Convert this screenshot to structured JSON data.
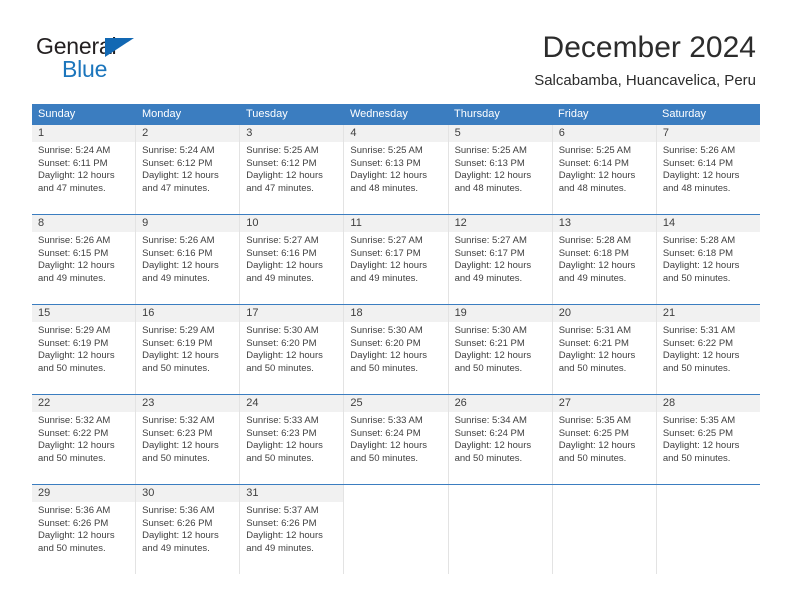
{
  "logo": {
    "word_one": "General",
    "word_two": "Blue",
    "triangle_icon": "triangle-icon",
    "primary_color": "#1b75bc",
    "dark_color": "#231f20"
  },
  "header": {
    "title": "December 2024",
    "subtitle": "Salcabamba, Huancavelica, Peru"
  },
  "calendar": {
    "header_bg": "#3b7dc0",
    "weekdays": [
      "Sunday",
      "Monday",
      "Tuesday",
      "Wednesday",
      "Thursday",
      "Friday",
      "Saturday"
    ],
    "weeks": [
      [
        {
          "day": "1",
          "sunrise": "Sunrise: 5:24 AM",
          "sunset": "Sunset: 6:11 PM",
          "daylight": "Daylight: 12 hours and 47 minutes."
        },
        {
          "day": "2",
          "sunrise": "Sunrise: 5:24 AM",
          "sunset": "Sunset: 6:12 PM",
          "daylight": "Daylight: 12 hours and 47 minutes."
        },
        {
          "day": "3",
          "sunrise": "Sunrise: 5:25 AM",
          "sunset": "Sunset: 6:12 PM",
          "daylight": "Daylight: 12 hours and 47 minutes."
        },
        {
          "day": "4",
          "sunrise": "Sunrise: 5:25 AM",
          "sunset": "Sunset: 6:13 PM",
          "daylight": "Daylight: 12 hours and 48 minutes."
        },
        {
          "day": "5",
          "sunrise": "Sunrise: 5:25 AM",
          "sunset": "Sunset: 6:13 PM",
          "daylight": "Daylight: 12 hours and 48 minutes."
        },
        {
          "day": "6",
          "sunrise": "Sunrise: 5:25 AM",
          "sunset": "Sunset: 6:14 PM",
          "daylight": "Daylight: 12 hours and 48 minutes."
        },
        {
          "day": "7",
          "sunrise": "Sunrise: 5:26 AM",
          "sunset": "Sunset: 6:14 PM",
          "daylight": "Daylight: 12 hours and 48 minutes."
        }
      ],
      [
        {
          "day": "8",
          "sunrise": "Sunrise: 5:26 AM",
          "sunset": "Sunset: 6:15 PM",
          "daylight": "Daylight: 12 hours and 49 minutes."
        },
        {
          "day": "9",
          "sunrise": "Sunrise: 5:26 AM",
          "sunset": "Sunset: 6:16 PM",
          "daylight": "Daylight: 12 hours and 49 minutes."
        },
        {
          "day": "10",
          "sunrise": "Sunrise: 5:27 AM",
          "sunset": "Sunset: 6:16 PM",
          "daylight": "Daylight: 12 hours and 49 minutes."
        },
        {
          "day": "11",
          "sunrise": "Sunrise: 5:27 AM",
          "sunset": "Sunset: 6:17 PM",
          "daylight": "Daylight: 12 hours and 49 minutes."
        },
        {
          "day": "12",
          "sunrise": "Sunrise: 5:27 AM",
          "sunset": "Sunset: 6:17 PM",
          "daylight": "Daylight: 12 hours and 49 minutes."
        },
        {
          "day": "13",
          "sunrise": "Sunrise: 5:28 AM",
          "sunset": "Sunset: 6:18 PM",
          "daylight": "Daylight: 12 hours and 49 minutes."
        },
        {
          "day": "14",
          "sunrise": "Sunrise: 5:28 AM",
          "sunset": "Sunset: 6:18 PM",
          "daylight": "Daylight: 12 hours and 50 minutes."
        }
      ],
      [
        {
          "day": "15",
          "sunrise": "Sunrise: 5:29 AM",
          "sunset": "Sunset: 6:19 PM",
          "daylight": "Daylight: 12 hours and 50 minutes."
        },
        {
          "day": "16",
          "sunrise": "Sunrise: 5:29 AM",
          "sunset": "Sunset: 6:19 PM",
          "daylight": "Daylight: 12 hours and 50 minutes."
        },
        {
          "day": "17",
          "sunrise": "Sunrise: 5:30 AM",
          "sunset": "Sunset: 6:20 PM",
          "daylight": "Daylight: 12 hours and 50 minutes."
        },
        {
          "day": "18",
          "sunrise": "Sunrise: 5:30 AM",
          "sunset": "Sunset: 6:20 PM",
          "daylight": "Daylight: 12 hours and 50 minutes."
        },
        {
          "day": "19",
          "sunrise": "Sunrise: 5:30 AM",
          "sunset": "Sunset: 6:21 PM",
          "daylight": "Daylight: 12 hours and 50 minutes."
        },
        {
          "day": "20",
          "sunrise": "Sunrise: 5:31 AM",
          "sunset": "Sunset: 6:21 PM",
          "daylight": "Daylight: 12 hours and 50 minutes."
        },
        {
          "day": "21",
          "sunrise": "Sunrise: 5:31 AM",
          "sunset": "Sunset: 6:22 PM",
          "daylight": "Daylight: 12 hours and 50 minutes."
        }
      ],
      [
        {
          "day": "22",
          "sunrise": "Sunrise: 5:32 AM",
          "sunset": "Sunset: 6:22 PM",
          "daylight": "Daylight: 12 hours and 50 minutes."
        },
        {
          "day": "23",
          "sunrise": "Sunrise: 5:32 AM",
          "sunset": "Sunset: 6:23 PM",
          "daylight": "Daylight: 12 hours and 50 minutes."
        },
        {
          "day": "24",
          "sunrise": "Sunrise: 5:33 AM",
          "sunset": "Sunset: 6:23 PM",
          "daylight": "Daylight: 12 hours and 50 minutes."
        },
        {
          "day": "25",
          "sunrise": "Sunrise: 5:33 AM",
          "sunset": "Sunset: 6:24 PM",
          "daylight": "Daylight: 12 hours and 50 minutes."
        },
        {
          "day": "26",
          "sunrise": "Sunrise: 5:34 AM",
          "sunset": "Sunset: 6:24 PM",
          "daylight": "Daylight: 12 hours and 50 minutes."
        },
        {
          "day": "27",
          "sunrise": "Sunrise: 5:35 AM",
          "sunset": "Sunset: 6:25 PM",
          "daylight": "Daylight: 12 hours and 50 minutes."
        },
        {
          "day": "28",
          "sunrise": "Sunrise: 5:35 AM",
          "sunset": "Sunset: 6:25 PM",
          "daylight": "Daylight: 12 hours and 50 minutes."
        }
      ],
      [
        {
          "day": "29",
          "sunrise": "Sunrise: 5:36 AM",
          "sunset": "Sunset: 6:26 PM",
          "daylight": "Daylight: 12 hours and 50 minutes."
        },
        {
          "day": "30",
          "sunrise": "Sunrise: 5:36 AM",
          "sunset": "Sunset: 6:26 PM",
          "daylight": "Daylight: 12 hours and 49 minutes."
        },
        {
          "day": "31",
          "sunrise": "Sunrise: 5:37 AM",
          "sunset": "Sunset: 6:26 PM",
          "daylight": "Daylight: 12 hours and 49 minutes."
        },
        {
          "day": "",
          "sunrise": "",
          "sunset": "",
          "daylight": ""
        },
        {
          "day": "",
          "sunrise": "",
          "sunset": "",
          "daylight": ""
        },
        {
          "day": "",
          "sunrise": "",
          "sunset": "",
          "daylight": ""
        },
        {
          "day": "",
          "sunrise": "",
          "sunset": "",
          "daylight": ""
        }
      ]
    ]
  }
}
